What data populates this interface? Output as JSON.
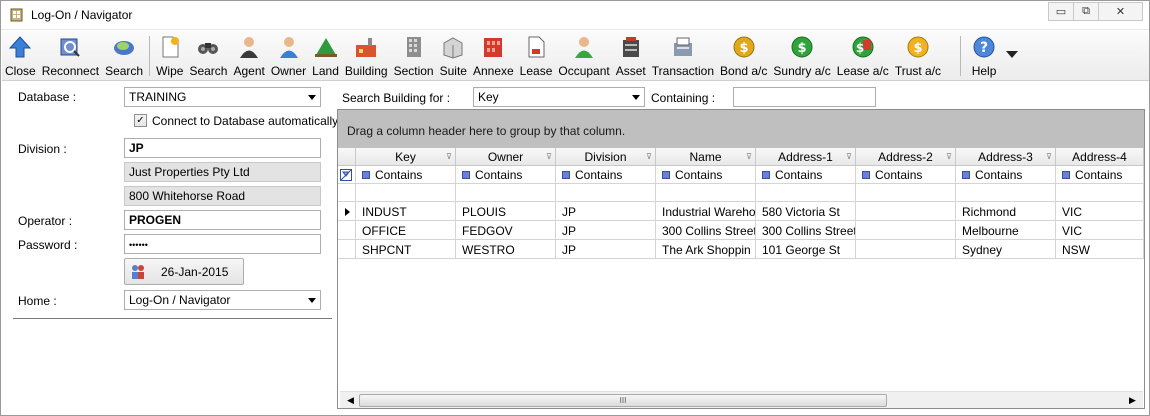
{
  "window": {
    "title": "Log-On / Navigator",
    "controls": {
      "minimize": "▭",
      "maximize": "⧉",
      "close": "✕"
    }
  },
  "toolbar": {
    "buttons": [
      {
        "label": "Close",
        "icon": "up-arrow-icon"
      },
      {
        "label": "Reconnect",
        "icon": "reconnect-icon"
      },
      {
        "label": "Search",
        "icon": "search-globe-icon"
      },
      {
        "label": "Wipe",
        "icon": "wipe-icon"
      },
      {
        "label": "Search",
        "icon": "binoculars-icon"
      },
      {
        "label": "Agent",
        "icon": "agent-icon"
      },
      {
        "label": "Owner",
        "icon": "owner-icon"
      },
      {
        "label": "Land",
        "icon": "land-icon"
      },
      {
        "label": "Building",
        "icon": "building-icon"
      },
      {
        "label": "Section",
        "icon": "section-icon"
      },
      {
        "label": "Suite",
        "icon": "suite-icon"
      },
      {
        "label": "Annexe",
        "icon": "annexe-icon"
      },
      {
        "label": "Lease",
        "icon": "lease-icon"
      },
      {
        "label": "Occupant",
        "icon": "occupant-icon"
      },
      {
        "label": "Asset",
        "icon": "asset-icon"
      },
      {
        "label": "Transaction",
        "icon": "transaction-icon"
      },
      {
        "label": "Bond a/c",
        "icon": "bond-account-icon"
      },
      {
        "label": "Sundry a/c",
        "icon": "sundry-account-icon"
      },
      {
        "label": "Lease a/c",
        "icon": "lease-account-icon"
      },
      {
        "label": "Trust a/c",
        "icon": "trust-account-icon"
      },
      {
        "label": "Help",
        "icon": "help-icon"
      }
    ]
  },
  "login": {
    "database_label": "Database :",
    "database_value": "TRAINING",
    "connect_auto_label": "Connect to Database automatically",
    "connect_auto_checked": "✓",
    "division_label": "Division :",
    "division_code": "JP",
    "division_name": "Just Properties Pty Ltd",
    "division_address": "800 Whitehorse Road",
    "operator_label": "Operator :",
    "operator_value": "PROGEN",
    "password_label": "Password :",
    "password_value": "••••••",
    "date_value": "26-Jan-2015",
    "home_label": "Home :",
    "home_value": "Log-On / Navigator"
  },
  "search": {
    "label": "Search Building for :",
    "field_value": "Key",
    "containing_label": "Containing :",
    "containing_value": ""
  },
  "grid": {
    "group_hint": "Drag a column header here to group by that column.",
    "columns": [
      "Key",
      "Owner",
      "Division",
      "Name",
      "Address-1",
      "Address-2",
      "Address-3",
      "Address-4"
    ],
    "filter_label": "Contains",
    "rows": [
      [
        "INDUST",
        "PLOUIS",
        "JP",
        "Industrial Wareho",
        "580 Victoria St",
        "",
        "Richmond",
        "VIC"
      ],
      [
        "OFFICE",
        "FEDGOV",
        "JP",
        "300 Collins Street",
        "300 Collins Street",
        "",
        "Melbourne",
        "VIC"
      ],
      [
        "SHPCNT",
        "WESTRO",
        "JP",
        "The Ark Shoppin",
        "101 George St",
        "",
        "Sydney",
        "NSW"
      ]
    ],
    "scroll_grip": "III"
  }
}
